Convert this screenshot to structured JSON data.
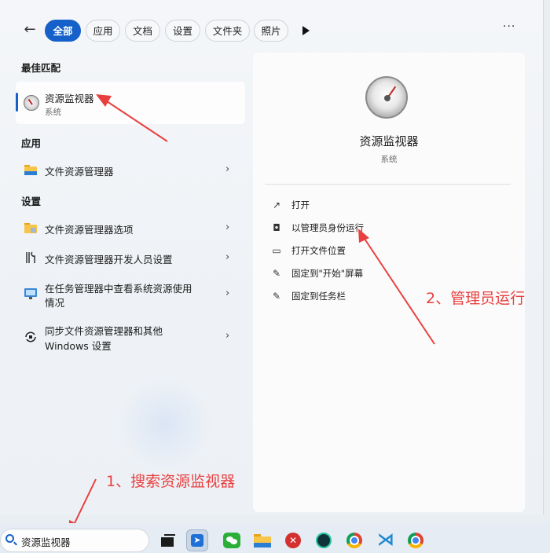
{
  "filter_bar": {
    "back_glyph": "←",
    "chips": [
      "全部",
      "应用",
      "文档",
      "设置",
      "文件夹",
      "照片"
    ],
    "overflow_glyph": "···"
  },
  "best_match": {
    "heading": "最佳匹配",
    "title": "资源监视器",
    "subtitle": "系统",
    "icon": "resource-monitor-gauge-icon"
  },
  "apps": {
    "heading": "应用",
    "items": [
      {
        "label": "文件资源管理器",
        "icon": "folder-icon"
      }
    ]
  },
  "settings": {
    "heading": "设置",
    "items": [
      {
        "label": "文件资源管理器选项",
        "icon": "folder-options-icon"
      },
      {
        "label": "文件资源管理器开发人员设置",
        "icon": "developer-tools-icon"
      },
      {
        "label_line1": "在任务管理器中查看系统资源使用",
        "label_line2": "情况",
        "icon": "monitor-icon"
      },
      {
        "label_line1": "同步文件资源管理器和其他",
        "label_line2": "Windows 设置",
        "icon": "sync-icon"
      }
    ]
  },
  "details": {
    "title": "资源监视器",
    "subtitle": "系统",
    "actions": [
      {
        "label": "打开",
        "icon": "open-external-icon"
      },
      {
        "label": "以管理员身份运行",
        "icon": "admin-shield-icon"
      },
      {
        "label": "打开文件位置",
        "icon": "folder-open-icon"
      },
      {
        "label": "固定到\"开始\"屏幕",
        "icon": "pin-icon"
      },
      {
        "label": "固定到任务栏",
        "icon": "pin-icon"
      }
    ]
  },
  "annotations": {
    "step1": "1、搜索资源监视器",
    "step2": "2、管理员运行",
    "color": "#e8403f"
  },
  "taskbar": {
    "search_value": "资源监视器",
    "apps": [
      "task-view-icon",
      "pointer-app-icon",
      "wechat-icon",
      "file-explorer-icon",
      "red-app-icon",
      "dark-app-icon",
      "chrome-icon",
      "vscode-icon",
      "chrome-icon"
    ]
  }
}
